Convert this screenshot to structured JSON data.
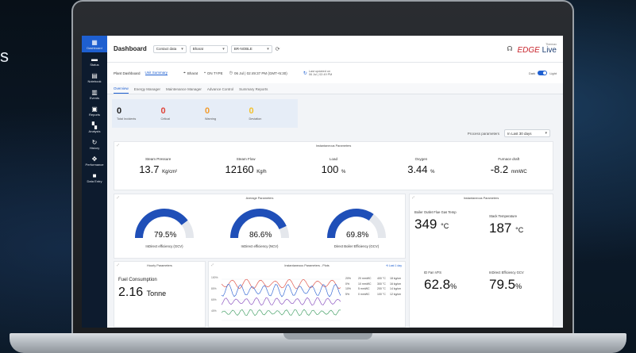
{
  "background_text": "s",
  "sidebar": {
    "items": [
      {
        "icon": "dashboard-icon",
        "label": "Dashboard",
        "glyph": "▦"
      },
      {
        "icon": "alarms-icon",
        "label": "Status",
        "glyph": "▬"
      },
      {
        "icon": "notebook-icon",
        "label": "Notebook",
        "glyph": "▤"
      },
      {
        "icon": "events-icon",
        "label": "Events",
        "glyph": "▥"
      },
      {
        "icon": "reports-icon",
        "label": "Reports",
        "glyph": "▣"
      },
      {
        "icon": "analysis-icon",
        "label": "Analysis",
        "glyph": "▚"
      },
      {
        "icon": "history-icon",
        "label": "History",
        "glyph": "↻"
      },
      {
        "icon": "performance-icon",
        "label": "Performance",
        "glyph": "✥"
      },
      {
        "icon": "data-entry-icon",
        "label": "Data Entry",
        "glyph": "■"
      }
    ]
  },
  "topbar": {
    "title": "Dashboard",
    "selects": [
      "Contact data",
      "Bharat",
      "BR-NOBLE"
    ],
    "brand_top": "Thermax",
    "brand_name": "EDGE",
    "brand_live": "Live"
  },
  "subhead": {
    "crumbs": [
      "Plant Dashboard",
      "Unit Summary"
    ],
    "location": "Bharat",
    "status": "ON TYPE",
    "datetime": "06 Jul | 02:49:37 PM (GMT+5:30)",
    "last_update_label": "Last updated on",
    "last_update_value": "06 Jul | 02:49 PM",
    "theme_dark": "Dark",
    "theme_light": "Light"
  },
  "tabs": [
    "Overview",
    "Energy Manager",
    "Maintenance Manager",
    "Advance Control",
    "Summary Reports"
  ],
  "incidents": [
    {
      "value": "0",
      "label": "Total Incidents",
      "color": "#222222"
    },
    {
      "value": "0",
      "label": "Critical",
      "color": "#e0443a"
    },
    {
      "value": "0",
      "label": "Warning",
      "color": "#f29b2c"
    },
    {
      "value": "0",
      "label": "Deviation",
      "color": "#f2c12c"
    }
  ],
  "process_params": {
    "label": "Process parameters",
    "range": "In Last 30 days"
  },
  "instant_top": {
    "title": "Instantaneous Parameters",
    "metrics": [
      {
        "label": "Steam Pressure",
        "value": "13.7",
        "unit": "Kg/cm²"
      },
      {
        "label": "Steam Flow",
        "value": "12160",
        "unit": "Kg/h"
      },
      {
        "label": "Load",
        "value": "100",
        "unit": "%"
      },
      {
        "label": "Oxygen",
        "value": "3.44",
        "unit": "%"
      },
      {
        "label": "Furnace draft",
        "value": "-8.2",
        "unit": "mmWC"
      }
    ]
  },
  "average": {
    "title": "Average Parameters",
    "gauges": [
      {
        "value": "79.5%",
        "fraction": 0.795,
        "label": "InDirect efficiency (GCV)"
      },
      {
        "value": "86.6%",
        "fraction": 0.866,
        "label": "InDirect efficiency (NCV)"
      },
      {
        "value": "69.8%",
        "fraction": 0.698,
        "label": "Direct Boiler Efficiency (GCV)"
      }
    ],
    "gauge_color": "#1f4fb8",
    "gauge_track": "#e4e7ec"
  },
  "instant_right": {
    "title": "Instantaneous Parameters",
    "metrics": [
      {
        "label": "Boiler Outlet Flue Gas Temp",
        "value": "349",
        "unit": "°C"
      },
      {
        "label": "Stack Temperature",
        "value": "187",
        "unit": "°C"
      },
      {
        "label": "ID Fan VFS",
        "value": "62.8",
        "unit": "%"
      },
      {
        "label": "InDirect Efficiency GCV",
        "value": "79.5",
        "unit": "%"
      }
    ]
  },
  "hourly": {
    "title": "Hourly Parameters",
    "fuel_label": "Fuel Consumption",
    "fuel_value": "2.16",
    "fuel_unit": "Tonne"
  },
  "trend": {
    "title": "Instantaneous Parameters - Plots",
    "link": "⟲ Last 1 day",
    "y_left": [
      "100%",
      "80%",
      "60%",
      "40%"
    ],
    "legend_a": [
      "20%",
      "0%",
      "10%",
      "5%"
    ],
    "legend_b": [
      "20 mmWC",
      "10 mmWC",
      "5 mmWC",
      "0 mmWC"
    ],
    "legend_c": [
      "400 °C",
      "300 °C",
      "200 °C",
      "100 °C"
    ],
    "legend_d": [
      "18 kg/cm",
      "16 kg/cm",
      "14 kg/cm",
      "12 kg/cm"
    ],
    "series_colors": [
      "#e05a4f",
      "#3d6fd6",
      "#8e57c2",
      "#4aa36b"
    ]
  }
}
